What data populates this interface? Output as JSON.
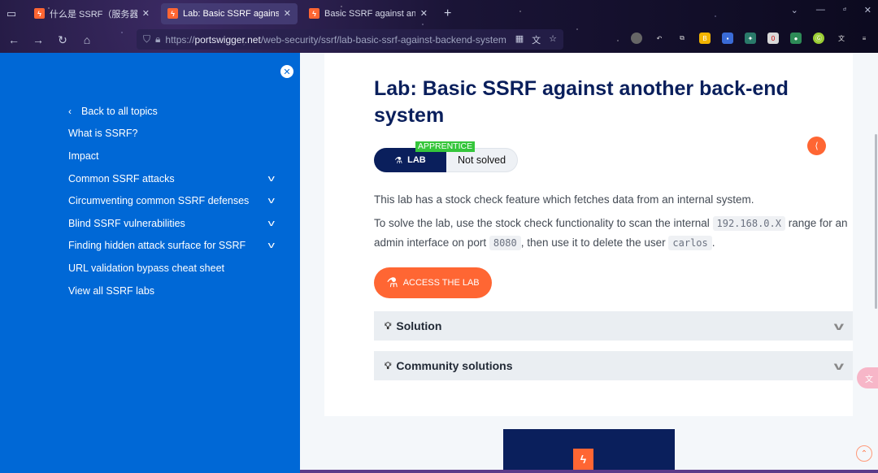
{
  "browser": {
    "tabs": [
      {
        "title": "什么是 SSRF（服务器端请求伪",
        "active": false
      },
      {
        "title": "Lab: Basic SSRF against anoth",
        "active": true
      },
      {
        "title": "Basic SSRF against another b",
        "active": false
      }
    ],
    "url_scheme": "https://",
    "url_host": "portswigger.net",
    "url_path": "/web-security/ssrf/lab-basic-ssrf-against-backend-system",
    "new_tab": "+",
    "close_glyph": "✕"
  },
  "sidebar": {
    "close": "✕",
    "back_label": "Back to all topics",
    "items": [
      {
        "label": "What is SSRF?",
        "expandable": false
      },
      {
        "label": "Impact",
        "expandable": false
      },
      {
        "label": "Common SSRF attacks",
        "expandable": true
      },
      {
        "label": "Circumventing common SSRF defenses",
        "expandable": true
      },
      {
        "label": "Blind SSRF vulnerabilities",
        "expandable": true
      },
      {
        "label": "Finding hidden attack surface for SSRF",
        "expandable": true
      },
      {
        "label": "URL validation bypass cheat sheet",
        "expandable": false
      },
      {
        "label": "View all SSRF labs",
        "expandable": false
      }
    ]
  },
  "lab": {
    "title": "Lab: Basic SSRF against another back-end system",
    "badge_type": "LAB",
    "badge_level": "APPRENTICE",
    "badge_status": "Not solved",
    "intro": "This lab has a stock check feature which fetches data from an internal system.",
    "task_part1": "To solve the lab, use the stock check functionality to scan the internal",
    "task_code1": "192.168.0.X",
    "task_part2": "range for an admin interface on port",
    "task_code2": "8080",
    "task_part3": ", then use it to delete the user",
    "task_code3": "carlos",
    "task_part4": ".",
    "access_button": "ACCESS THE LAB",
    "accordions": [
      {
        "label": "Solution",
        "icon": "lightbulb-icon"
      },
      {
        "label": "Community solutions",
        "icon": "community-icon"
      }
    ]
  },
  "colors": {
    "sidebar_blue": "#0068d6",
    "title_navy": "#0a1f5c",
    "accent_orange": "#ff6633",
    "level_green": "#35c63b"
  }
}
